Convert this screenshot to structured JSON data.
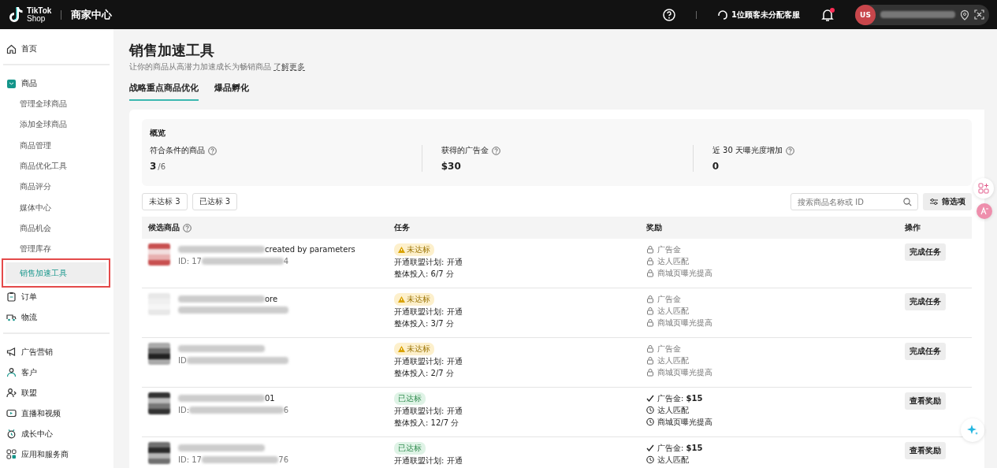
{
  "header": {
    "logo_top": "TikTok",
    "logo_bottom": "Shop",
    "title": "商家中心",
    "service": "1位顾客未分配客服",
    "notification_dot": true,
    "avatar": "US"
  },
  "sidebar": {
    "sections": [
      {
        "items": [
          {
            "label": "首页",
            "kind": "home",
            "selected": false
          }
        ]
      },
      {
        "items": [
          {
            "label": "商品",
            "kind": "bag",
            "selected": false,
            "children": [
              {
                "label": "管理全球商品",
                "selected": false
              },
              {
                "label": "添加全球商品",
                "selected": false
              },
              {
                "label": "商品管理",
                "selected": false
              },
              {
                "label": "商品优化工具",
                "selected": false
              },
              {
                "label": "商品评分",
                "selected": false
              },
              {
                "label": "媒体中心",
                "selected": false
              },
              {
                "label": "商品机会",
                "selected": false
              },
              {
                "label": "管理库存",
                "selected": false
              },
              {
                "label": "销售加速工具",
                "selected": true
              }
            ]
          },
          {
            "label": "订单",
            "kind": "clipboard",
            "selected": false
          },
          {
            "label": "物流",
            "kind": "truck",
            "selected": false
          }
        ]
      },
      {
        "items": [
          {
            "label": "广告营销",
            "kind": "megaphone",
            "selected": false
          },
          {
            "label": "客户",
            "kind": "people",
            "selected": false
          },
          {
            "label": "联盟",
            "kind": "person",
            "selected": false
          },
          {
            "label": "直播和视频",
            "kind": "video",
            "selected": false
          },
          {
            "label": "成长中心",
            "kind": "clock",
            "selected": false
          },
          {
            "label": "应用和服务商",
            "kind": "grid",
            "selected": false
          }
        ]
      }
    ]
  },
  "page": {
    "title": "销售加速工具",
    "subtitle": "让你的商品从高潜力加速成长为畅销商品",
    "learn_more": "了解更多",
    "tabs": [
      {
        "label": "战略重点商品优化",
        "selected": true
      },
      {
        "label": "爆品孵化",
        "selected": false
      }
    ]
  },
  "overview": {
    "title": "概览",
    "stats": [
      {
        "label": "符合条件的商品",
        "value": "3",
        "total": "/6"
      },
      {
        "label": "获得的广告金",
        "value": "$30"
      },
      {
        "label": "近 30 天曝光度增加",
        "value": "0"
      }
    ]
  },
  "filters": [
    {
      "label": "未达标 3",
      "selected": false
    },
    {
      "label": "已达标 3",
      "selected": false
    }
  ],
  "search": {
    "placeholder": "搜索商品名称或 ID"
  },
  "filter_button": "筛选项",
  "table": {
    "columns": [
      "候选商品",
      "任务",
      "奖励",
      "操作"
    ],
    "rows": [
      {
        "name_tail": "created by parameters",
        "id_head": "ID: 17",
        "id_tail": "4",
        "status": {
          "kind": "unmet",
          "label": "未达标"
        },
        "tasks": [
          "开通联盟计划: 开通",
          "整体投入: 6/7 分"
        ],
        "rewards": [
          {
            "kind": "lock",
            "label": "广告金"
          },
          {
            "kind": "lock",
            "label": "达人匹配"
          },
          {
            "kind": "lock",
            "label": "商城页曝光提高"
          }
        ],
        "action": "完成任务"
      },
      {
        "name_tail": "ore",
        "status": {
          "kind": "unmet",
          "label": "未达标"
        },
        "tasks": [
          "开通联盟计划: 开通",
          "整体投入: 3/7 分"
        ],
        "rewards": [
          {
            "kind": "lock",
            "label": "广告金"
          },
          {
            "kind": "lock",
            "label": "达人匹配"
          },
          {
            "kind": "lock",
            "label": "商城页曝光提高"
          }
        ],
        "action": "完成任务"
      },
      {
        "name_tail": "",
        "id_head": "ID",
        "status": {
          "kind": "unmet",
          "label": "未达标"
        },
        "tasks": [
          "开通联盟计划: 开通",
          "整体投入: 2/7 分"
        ],
        "rewards": [
          {
            "kind": "lock",
            "label": "广告金"
          },
          {
            "kind": "lock",
            "label": "达人匹配"
          },
          {
            "kind": "lock",
            "label": "商城页曝光提高"
          }
        ],
        "action": "完成任务"
      },
      {
        "name_tail": "01",
        "id_head": "ID:",
        "id_tail": "6",
        "status": {
          "kind": "met",
          "label": "已达标"
        },
        "tasks": [
          "开通联盟计划: 开通",
          "整体投入: 12/7 分"
        ],
        "rewards": [
          {
            "kind": "check",
            "label": "广告金: **$15**"
          },
          {
            "kind": "clock",
            "label": "达人匹配"
          },
          {
            "kind": "clock",
            "label": "商城页曝光提高"
          }
        ],
        "action": "查看奖励"
      },
      {
        "name_tail": "",
        "id_head": "ID: 17",
        "id_tail": "76",
        "status": {
          "kind": "met",
          "label": "已达标"
        },
        "tasks": [
          "开通联盟计划: 开通"
        ],
        "rewards": [
          {
            "kind": "check",
            "label": "广告金: **$15**"
          },
          {
            "kind": "clock",
            "label": "达人匹配"
          }
        ],
        "action": "查看奖励"
      }
    ]
  }
}
